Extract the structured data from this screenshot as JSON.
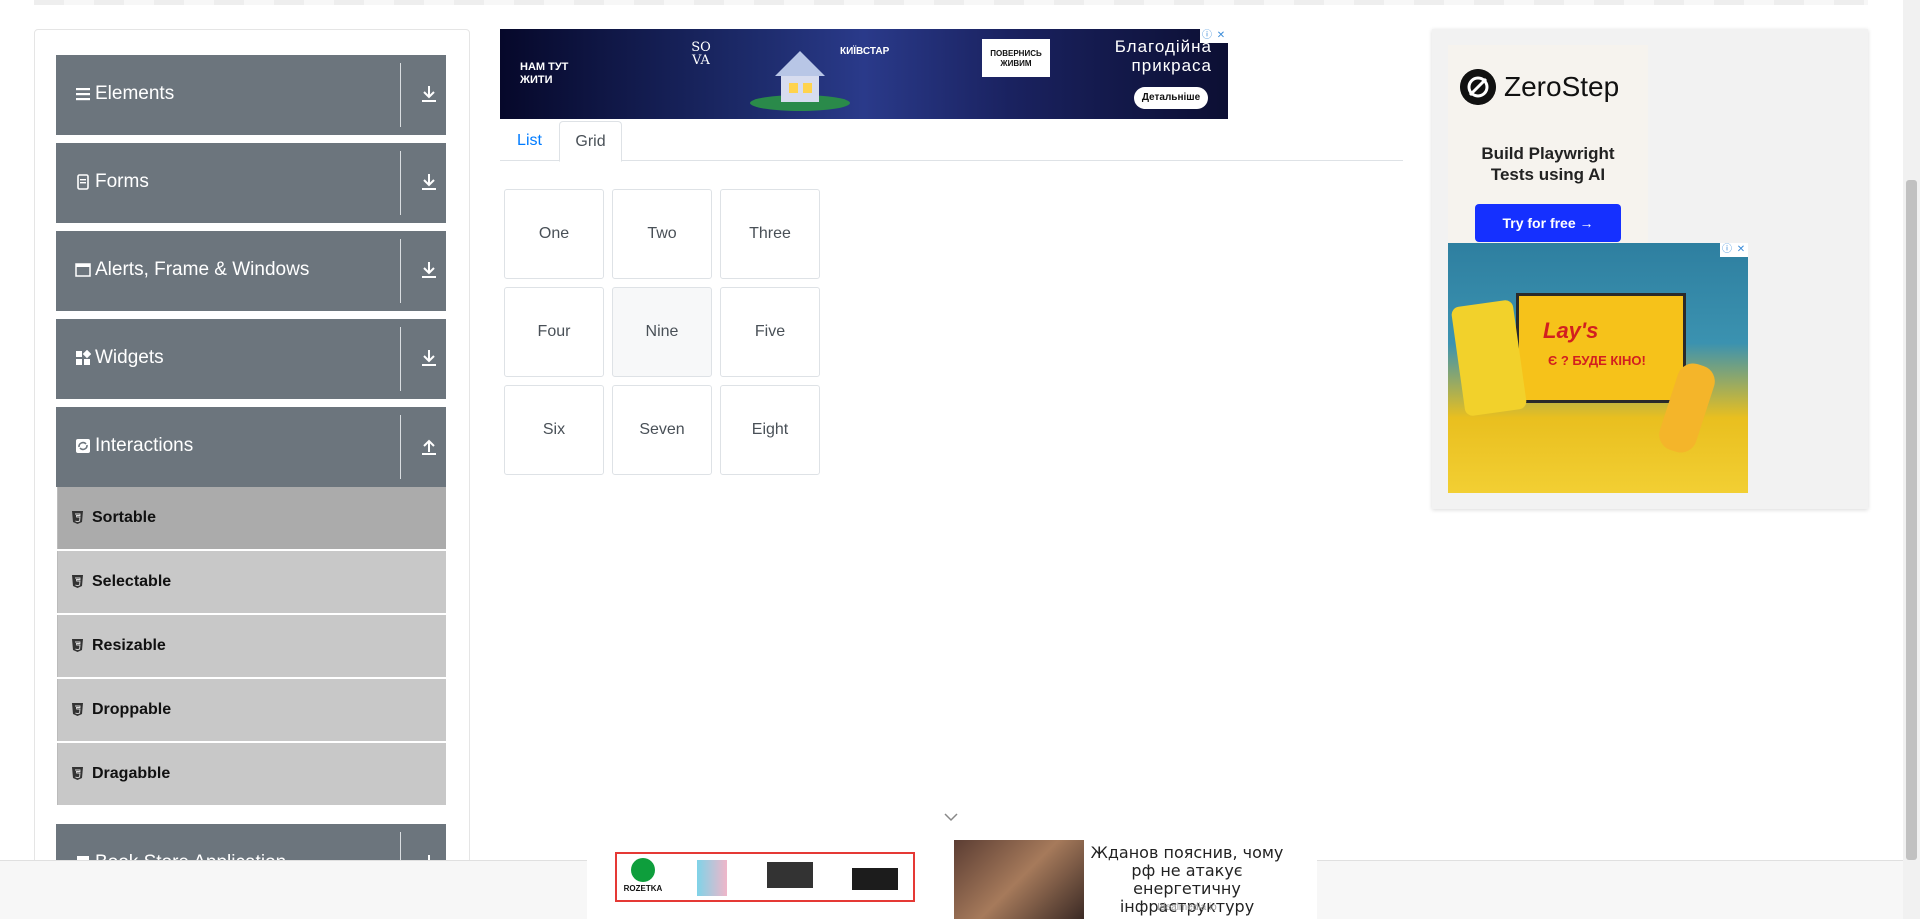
{
  "sidebar": {
    "groups": [
      {
        "label": "Elements",
        "icon": "list-icon",
        "expanded": false
      },
      {
        "label": "Forms",
        "icon": "form-icon",
        "expanded": false
      },
      {
        "label": "Alerts, Frame & Windows",
        "icon": "window-icon",
        "expanded": false
      },
      {
        "label": "Widgets",
        "icon": "widgets-icon",
        "expanded": false
      },
      {
        "label": "Interactions",
        "icon": "interactions-icon",
        "expanded": true
      },
      {
        "label": "Book Store Application",
        "icon": "book-icon",
        "expanded": false
      }
    ],
    "items": [
      {
        "label": "Sortable",
        "active": true
      },
      {
        "label": "Selectable",
        "active": false
      },
      {
        "label": "Resizable",
        "active": false
      },
      {
        "label": "Droppable",
        "active": false
      },
      {
        "label": "Dragabble",
        "active": false
      }
    ]
  },
  "top_ad": {
    "left_text": "НАМ ТУТ ЖИТИ",
    "brand_sova": "SO VA",
    "brand_kyivstar": "КИЇВСТАР",
    "return_text": "ПОВЕРНИСЬ ЖИВИМ",
    "title_line1": "Благодійна",
    "title_line2": "прикраса",
    "button": "Детальніше"
  },
  "tabs": {
    "list": "List",
    "grid": "Grid",
    "active": "Grid"
  },
  "grid_items": [
    "One",
    "Two",
    "Three",
    "Four",
    "Nine",
    "Five",
    "Six",
    "Seven",
    "Eight"
  ],
  "right_ad": {
    "brand": "ZeroStep",
    "tagline": "Build Playwright Tests using AI",
    "button": "Try for free →",
    "lays_logo": "Lay's",
    "lays_text": "Є ? БУДЕ КІНО!"
  },
  "bottom_ad": {
    "rozetka": "ROZETKA",
    "headline": "Жданов пояснив, чому рф не атакує енергетичну інфраструктуру",
    "source": "Idealmedia.io"
  },
  "colors": {
    "group_header_bg": "#6c757d",
    "menu_item_bg": "#c8c8c8",
    "menu_item_active_bg": "#ababab",
    "tab_active_link": "#007bff",
    "zerostep_button": "#1530ff"
  }
}
